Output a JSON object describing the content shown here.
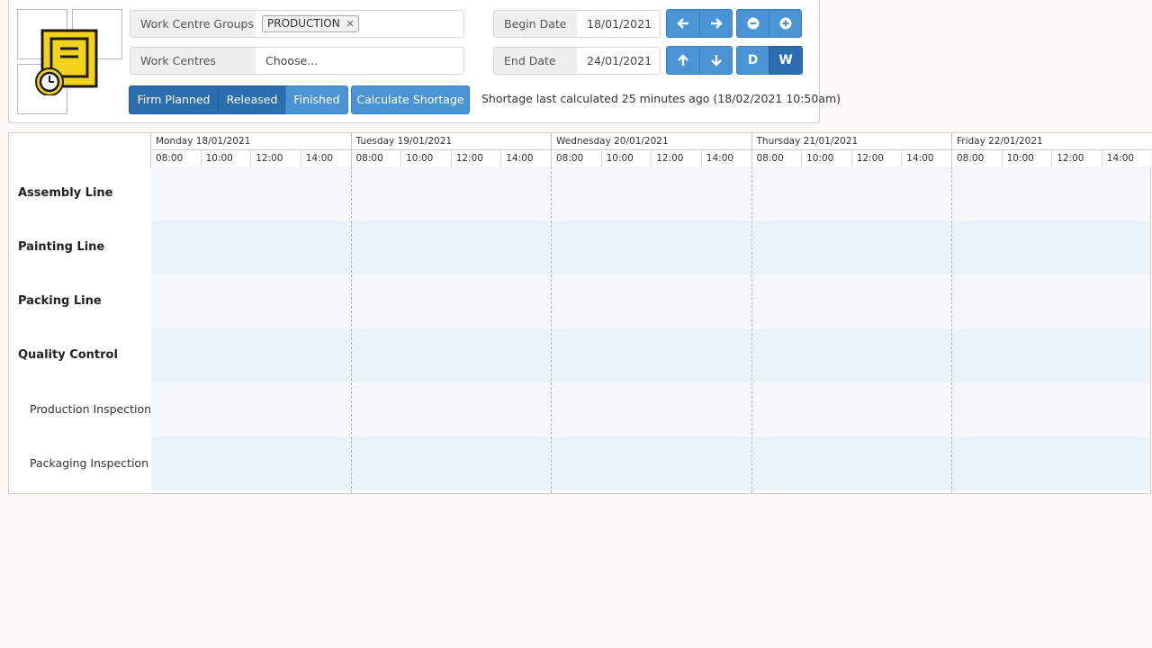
{
  "filters": {
    "work_centre_groups_label": "Work Centre Groups",
    "work_centre_groups_tag": "PRODUCTION",
    "work_centres_label": "Work Centres",
    "work_centres_placeholder": "Choose...",
    "begin_date_label": "Begin Date",
    "begin_date_value": "18/01/2021",
    "end_date_label": "End Date",
    "end_date_value": "24/01/2021"
  },
  "nav": {
    "left_icon": "arrow-left-icon",
    "right_icon": "arrow-right-icon",
    "up_icon": "arrow-up-icon",
    "down_icon": "arrow-down-icon",
    "zoom_out_icon": "minus-circle-icon",
    "zoom_in_icon": "plus-circle-icon",
    "day_label": "D",
    "week_label": "W"
  },
  "status_filters": [
    "Firm Planned",
    "Released",
    "Finished"
  ],
  "calculate_label": "Calculate Shortage",
  "shortage_status": "Shortage last calculated 25 minutes ago (18/02/2021 10:50am)",
  "timeline": {
    "days": [
      "Monday 18/01/2021",
      "Tuesday 19/01/2021",
      "Wednesday 20/01/2021",
      "Thursday 21/01/2021",
      "Friday 22/01/2021"
    ],
    "hours": [
      "08:00",
      "10:00",
      "12:00",
      "14:00"
    ]
  },
  "rows": [
    {
      "label": "Assembly Line",
      "level": 0
    },
    {
      "label": "Painting Line",
      "level": 0
    },
    {
      "label": "Packing Line",
      "level": 0
    },
    {
      "label": "Quality Control",
      "level": 0
    },
    {
      "label": "Production Inspection",
      "level": 1
    },
    {
      "label": "Packaging Inspection",
      "level": 1
    }
  ],
  "colors": {
    "button_blue": "#4a93d5",
    "button_active": "#2b6eb0",
    "row_odd": "#f4f8fc",
    "row_even": "#eaf2fa",
    "scroll_handle": "#e4858d"
  }
}
